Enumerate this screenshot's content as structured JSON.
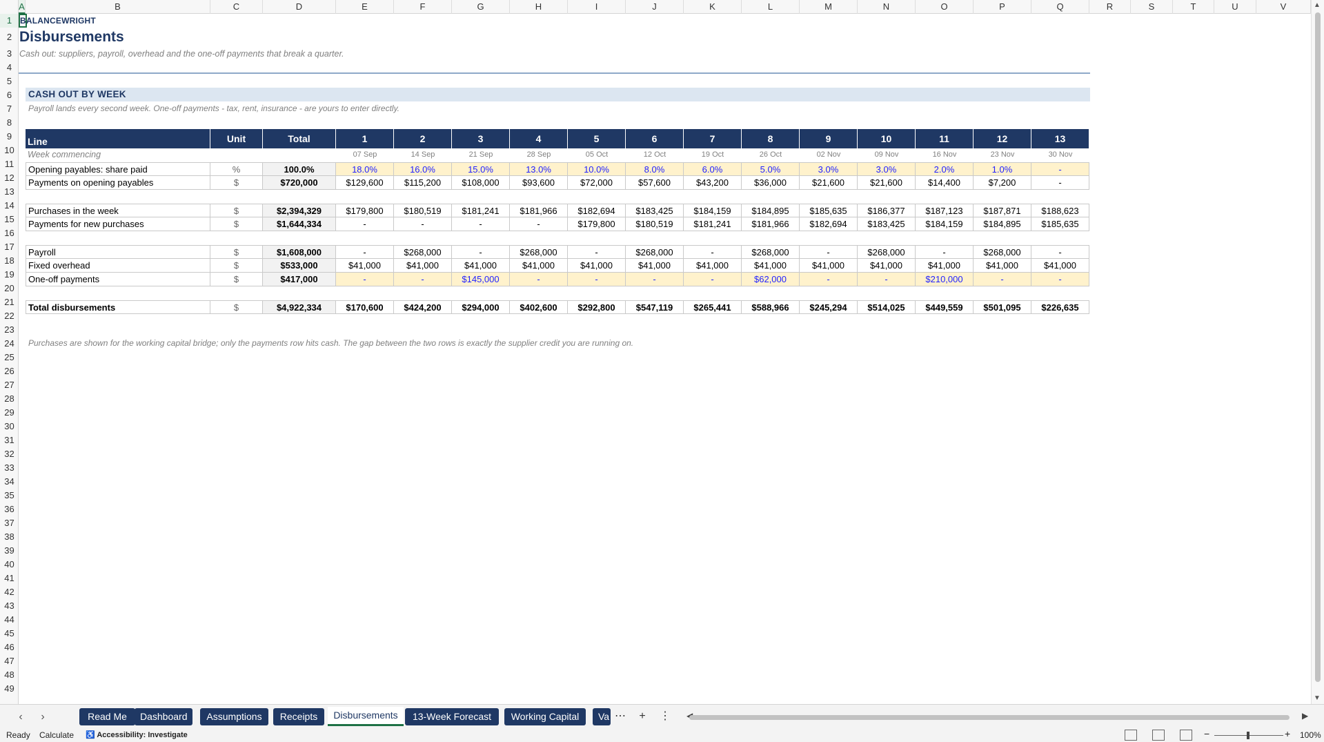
{
  "columns": [
    "A",
    "B",
    "C",
    "D",
    "E",
    "F",
    "G",
    "H",
    "I",
    "J",
    "K",
    "L",
    "M",
    "N",
    "O",
    "P",
    "Q",
    "R",
    "S",
    "T",
    "U",
    "V"
  ],
  "rows": [
    "1",
    "2",
    "3",
    "4",
    "5",
    "6",
    "7",
    "8",
    "9",
    "10",
    "11",
    "12",
    "13",
    "14",
    "15",
    "16",
    "17",
    "18",
    "19",
    "20",
    "21",
    "22",
    "23",
    "24",
    "25",
    "26",
    "27",
    "28",
    "29",
    "30",
    "31",
    "32",
    "33",
    "34",
    "35",
    "36",
    "37",
    "38",
    "39",
    "40",
    "41",
    "42",
    "43",
    "44",
    "45",
    "46",
    "47",
    "48",
    "49"
  ],
  "brand": "BALANCEWRIGHT",
  "title": "Disbursements",
  "subtitle": "Cash out: suppliers, payroll, overhead and the one-off payments that break a quarter.",
  "section_title": "CASH OUT BY WEEK",
  "section_note": "Payroll lands every second week. One-off payments - tax, rent, insurance - are yours to enter directly.",
  "table": {
    "header": {
      "line": "Line",
      "unit": "Unit",
      "total": "Total",
      "weeks": [
        "1",
        "2",
        "3",
        "4",
        "5",
        "6",
        "7",
        "8",
        "9",
        "10",
        "11",
        "12",
        "13"
      ]
    },
    "week_commencing": {
      "label": "Week commencing",
      "dates": [
        "07 Sep",
        "14 Sep",
        "21 Sep",
        "28 Sep",
        "05 Oct",
        "12 Oct",
        "19 Oct",
        "26 Oct",
        "02 Nov",
        "09 Nov",
        "16 Nov",
        "23 Nov",
        "30 Nov"
      ]
    },
    "share_paid": {
      "label": "Opening payables: share paid",
      "unit": "%",
      "total": "100.0%",
      "values": [
        "18.0%",
        "16.0%",
        "15.0%",
        "13.0%",
        "10.0%",
        "8.0%",
        "6.0%",
        "5.0%",
        "3.0%",
        "3.0%",
        "2.0%",
        "1.0%",
        "-"
      ]
    },
    "payments_opening": {
      "label": "Payments on opening payables",
      "unit": "$",
      "total": "$720,000",
      "values": [
        "$129,600",
        "$115,200",
        "$108,000",
        "$93,600",
        "$72,000",
        "$57,600",
        "$43,200",
        "$36,000",
        "$21,600",
        "$21,600",
        "$14,400",
        "$7,200",
        "-"
      ]
    },
    "purchases": {
      "label": "Purchases in the week",
      "unit": "$",
      "total": "$2,394,329",
      "values": [
        "$179,800",
        "$180,519",
        "$181,241",
        "$181,966",
        "$182,694",
        "$183,425",
        "$184,159",
        "$184,895",
        "$185,635",
        "$186,377",
        "$187,123",
        "$187,871",
        "$188,623"
      ]
    },
    "payments_new": {
      "label": "Payments for new purchases",
      "unit": "$",
      "total": "$1,644,334",
      "values": [
        "-",
        "-",
        "-",
        "-",
        "$179,800",
        "$180,519",
        "$181,241",
        "$181,966",
        "$182,694",
        "$183,425",
        "$184,159",
        "$184,895",
        "$185,635"
      ]
    },
    "payroll": {
      "label": "Payroll",
      "unit": "$",
      "total": "$1,608,000",
      "values": [
        "-",
        "$268,000",
        "-",
        "$268,000",
        "-",
        "$268,000",
        "-",
        "$268,000",
        "-",
        "$268,000",
        "-",
        "$268,000",
        "-"
      ]
    },
    "overhead": {
      "label": "Fixed overhead",
      "unit": "$",
      "total": "$533,000",
      "values": [
        "$41,000",
        "$41,000",
        "$41,000",
        "$41,000",
        "$41,000",
        "$41,000",
        "$41,000",
        "$41,000",
        "$41,000",
        "$41,000",
        "$41,000",
        "$41,000",
        "$41,000"
      ]
    },
    "oneoff": {
      "label": "One-off payments",
      "unit": "$",
      "total": "$417,000",
      "values": [
        "-",
        "-",
        "$145,000",
        "-",
        "-",
        "-",
        "-",
        "$62,000",
        "-",
        "-",
        "$210,000",
        "-",
        "-"
      ]
    },
    "total": {
      "label": "Total disbursements",
      "unit": "$",
      "total": "$4,922,334",
      "values": [
        "$170,600",
        "$424,200",
        "$294,000",
        "$402,600",
        "$292,800",
        "$547,119",
        "$265,441",
        "$588,966",
        "$245,294",
        "$514,025",
        "$449,559",
        "$501,095",
        "$226,635"
      ]
    }
  },
  "footnote": "Purchases are shown for the working capital bridge; only the payments row hits cash. The gap between the two rows is exactly the supplier credit you are running on.",
  "tabs": [
    "Read Me",
    "Dashboard",
    "Assumptions",
    "Receipts",
    "Disbursements",
    "13-Week Forecast",
    "Working Capital",
    "Va"
  ],
  "active_tab": "Disbursements",
  "status": {
    "ready": "Ready",
    "calculate": "Calculate",
    "accessibility": "Accessibility: Investigate",
    "zoom": "100%"
  },
  "colors": {
    "header_navy": "#1f3864",
    "input_fill": "#fff2cc",
    "input_text": "#1f1fff",
    "band": "#dce6f1",
    "excel_green": "#1e7145"
  }
}
